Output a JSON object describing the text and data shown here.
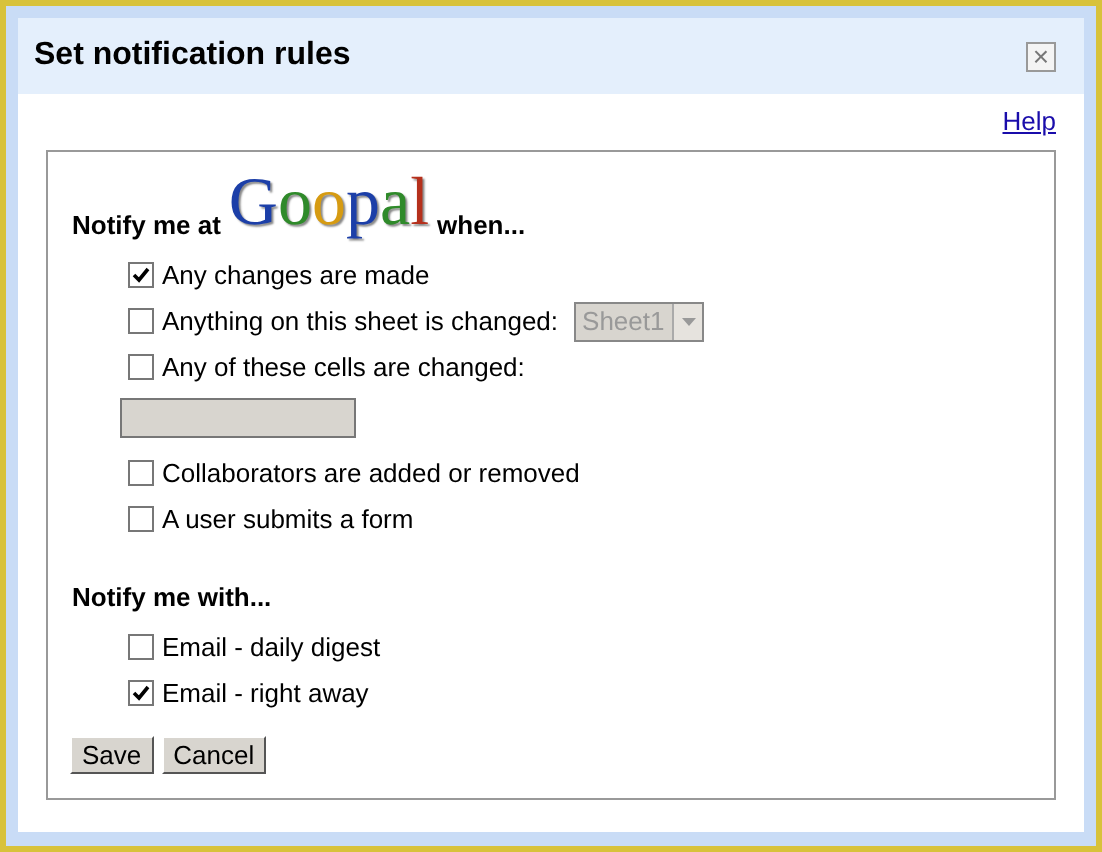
{
  "window": {
    "title": "Set notification rules",
    "close": "×"
  },
  "help_link": "Help",
  "when_section": {
    "prefix": "Notify me at",
    "logo": "Goopal",
    "suffix": "when...",
    "options": [
      {
        "kind": "checkbox",
        "label": "Any changes are made",
        "checked": true
      },
      {
        "kind": "select",
        "label": "Anything on this sheet is changed:",
        "checked": false,
        "select": {
          "value": "Sheet1",
          "disabled": true
        }
      },
      {
        "kind": "range",
        "label": "Any of these cells are changed:",
        "checked": false,
        "field": {
          "disabled": true
        }
      },
      {
        "kind": "checkbox",
        "label": "Collaborators are added or removed",
        "checked": false
      },
      {
        "kind": "checkbox",
        "label": "A user submits a form",
        "checked": false
      }
    ]
  },
  "with_section": {
    "title": "Notify me with...",
    "options": [
      {
        "kind": "checkbox",
        "label": "Email - daily digest",
        "checked": false
      },
      {
        "kind": "checkbox",
        "label": "Email - right away",
        "checked": true
      }
    ]
  },
  "buttons": [
    "Save",
    "Cancel"
  ]
}
